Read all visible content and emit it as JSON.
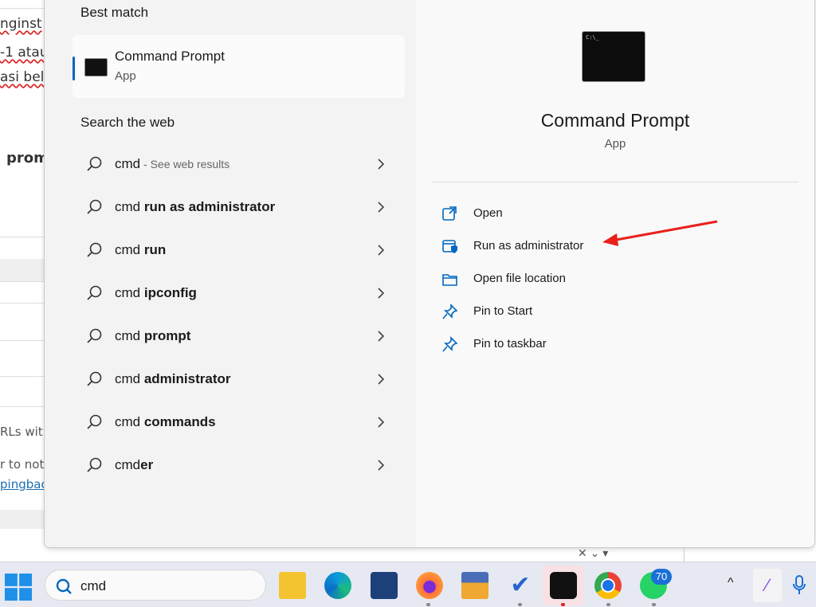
{
  "background_page": {
    "fragments": [
      "nginst",
      "-1 atau",
      "asi bel",
      "prom",
      "RLs with",
      "r to noti",
      "pingbac"
    ]
  },
  "start_menu": {
    "best_match_heading": "Best match",
    "best_match": {
      "title": "Command Prompt",
      "subtitle": "App",
      "icon": "command-prompt-icon"
    },
    "search_web_heading": "Search the web",
    "web_results": [
      {
        "prefix": "cmd",
        "bold": "",
        "suffix": " - See web results"
      },
      {
        "prefix": "cmd ",
        "bold": "run as administrator",
        "suffix": ""
      },
      {
        "prefix": "cmd ",
        "bold": "run",
        "suffix": ""
      },
      {
        "prefix": "cmd ",
        "bold": "ipconfig",
        "suffix": ""
      },
      {
        "prefix": "cmd ",
        "bold": "prompt",
        "suffix": ""
      },
      {
        "prefix": "cmd ",
        "bold": "administrator",
        "suffix": ""
      },
      {
        "prefix": "cmd ",
        "bold": "commands",
        "suffix": ""
      },
      {
        "prefix": "cmd",
        "bold": "er",
        "suffix": ""
      }
    ],
    "detail": {
      "title": "Command Prompt",
      "subtitle": "App",
      "icon_text": "C:\\_",
      "actions": [
        {
          "label": "Open",
          "icon": "open-external-icon"
        },
        {
          "label": "Run as administrator",
          "icon": "shield-window-icon"
        },
        {
          "label": "Open file location",
          "icon": "folder-icon"
        },
        {
          "label": "Pin to Start",
          "icon": "pin-icon"
        },
        {
          "label": "Pin to taskbar",
          "icon": "pin-icon"
        }
      ]
    },
    "annotation_color": "#e8211b",
    "accent": "#0067c0"
  },
  "taskbar": {
    "search_value": "cmd",
    "whatsapp_badge": "70",
    "apps": [
      "start",
      "file-explorer",
      "edge",
      "microsoft-store",
      "firefox",
      "medal-app",
      "todo",
      "webex",
      "chrome",
      "whatsapp"
    ]
  }
}
